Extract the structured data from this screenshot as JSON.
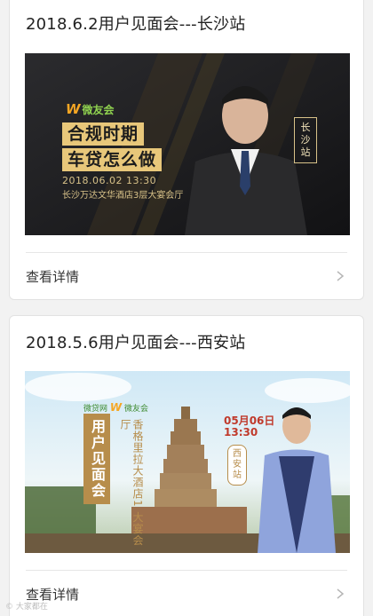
{
  "cards": [
    {
      "title": "2018.6.2用户见面会---长沙站",
      "details_label": "查看详情",
      "banner": {
        "logo_text": "微友会",
        "headline_1": "合规时期",
        "headline_2": "车贷怎么做",
        "date_time": "2018.06.02 13:30",
        "venue": "长沙万达文华酒店3层大宴会厅",
        "city_tag": "长沙站"
      }
    },
    {
      "title": "2018.5.6用户见面会---西安站",
      "details_label": "查看详情",
      "banner": {
        "logo_left": "微贷网",
        "logo_text": "微友会",
        "main_text": "用户见面会",
        "hotel_text": "香格里拉大酒店1 大宴会厅",
        "date_line_1": "05月06日",
        "date_line_2": "13:30",
        "city_tag": "西安站"
      }
    }
  ],
  "colors": {
    "page_bg": "#f2f2f2",
    "card_bg": "#ffffff",
    "banner1_gold": "#e8c77a",
    "banner2_gold": "#b78d4b"
  },
  "icons": {
    "chevron": "chevron-right-icon"
  },
  "watermark": "© 大家都在"
}
